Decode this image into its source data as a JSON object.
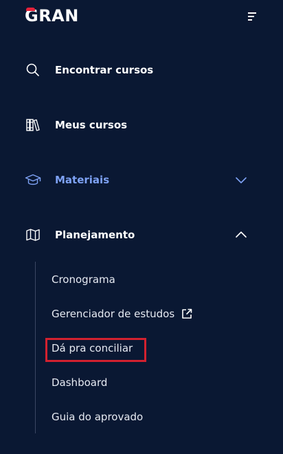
{
  "brand": {
    "logo_text": "GRAN",
    "accent_color": "#e5213a"
  },
  "header": {
    "menu_icon": "menu-icon"
  },
  "nav": {
    "items": [
      {
        "label": "Encontrar cursos",
        "icon": "search-icon"
      },
      {
        "label": "Meus cursos",
        "icon": "books-icon"
      },
      {
        "label": "Materiais",
        "icon": "graduation-cap-icon",
        "active": true,
        "expandable": true,
        "expanded": false
      },
      {
        "label": "Planejamento",
        "icon": "map-icon",
        "expandable": true,
        "expanded": true
      }
    ],
    "active_color": "#7ea2f5"
  },
  "submenu": {
    "items": [
      {
        "label": "Cronograma"
      },
      {
        "label": "Gerenciador de estudos",
        "icon": "external-link-icon"
      },
      {
        "label": "Dá pra conciliar",
        "highlighted": true
      },
      {
        "label": "Dashboard"
      },
      {
        "label": "Guia do aprovado"
      }
    ]
  },
  "colors": {
    "background": "#0a1833",
    "highlight_border": "#d3212f"
  }
}
